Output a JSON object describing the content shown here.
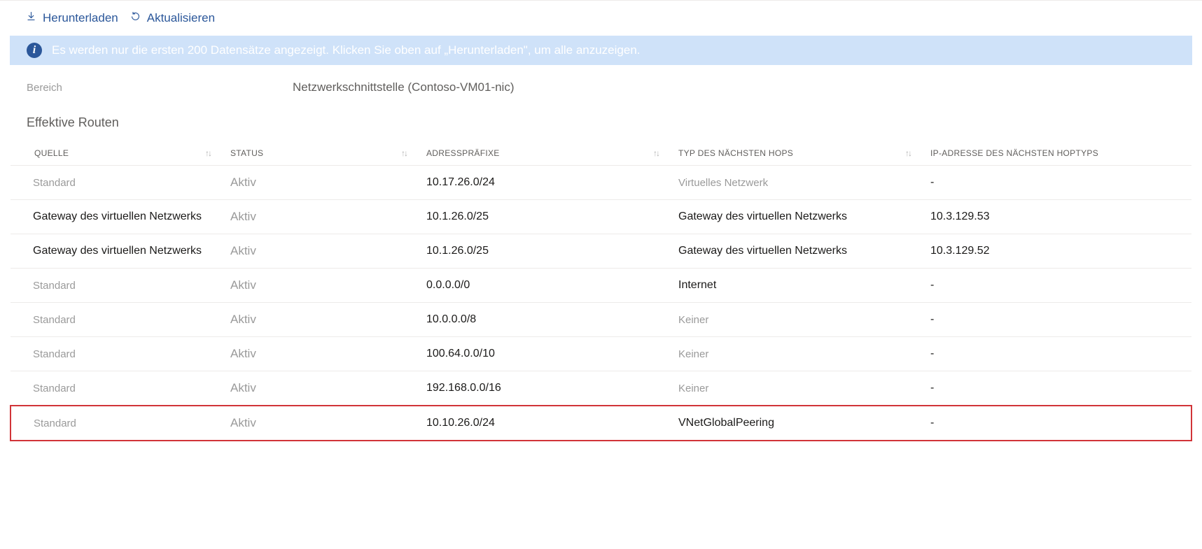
{
  "toolbar": {
    "download_label": "Herunterladen",
    "refresh_label": "Aktualisieren"
  },
  "info_message": "Es werden nur die ersten 200 Datensätze angezeigt. Klicken Sie oben auf „Herunterladen\", um alle anzuzeigen.",
  "scope": {
    "label": "Bereich",
    "value": "Netzwerkschnittstelle (Contoso-VM01-nic)"
  },
  "section_title": "Effektive Routen",
  "columns": {
    "source": "QUELLE",
    "status": "STATUS",
    "prefix": "ADRESSPRÄFIXE",
    "nexthop": "TYP DES NÄCHSTEN HOPS",
    "ip": "IP-ADRESSE DES NÄCHSTEN HOPTYPS"
  },
  "rows": [
    {
      "source": "Standard",
      "source_light": true,
      "status": "Aktiv",
      "prefix": "10.17.26.0/24",
      "nexthop": "Virtuelles Netzwerk",
      "nexthop_light": true,
      "ip": "-",
      "highlight": false
    },
    {
      "source": "Gateway des virtuellen Netzwerks",
      "source_light": false,
      "status": "Aktiv",
      "prefix": "10.1.26.0/25",
      "nexthop": "Gateway des virtuellen Netzwerks",
      "nexthop_light": false,
      "ip": "10.3.129.53",
      "highlight": false
    },
    {
      "source": "Gateway des virtuellen Netzwerks",
      "source_light": false,
      "status": "Aktiv",
      "prefix": "10.1.26.0/25",
      "nexthop": "Gateway des virtuellen Netzwerks",
      "nexthop_light": false,
      "ip": "10.3.129.52",
      "highlight": false
    },
    {
      "source": "Standard",
      "source_light": true,
      "status": "Aktiv",
      "prefix": "0.0.0.0/0",
      "nexthop": "Internet",
      "nexthop_light": false,
      "ip": "-",
      "highlight": false
    },
    {
      "source": "Standard",
      "source_light": true,
      "status": "Aktiv",
      "prefix": "10.0.0.0/8",
      "nexthop": "Keiner",
      "nexthop_light": true,
      "ip": "-",
      "highlight": false
    },
    {
      "source": "Standard",
      "source_light": true,
      "status": "Aktiv",
      "prefix": "100.64.0.0/10",
      "nexthop": "Keiner",
      "nexthop_light": true,
      "ip": "-",
      "highlight": false
    },
    {
      "source": "Standard",
      "source_light": true,
      "status": "Aktiv",
      "prefix": "192.168.0.0/16",
      "nexthop": "Keiner",
      "nexthop_light": true,
      "ip": "-",
      "highlight": false
    },
    {
      "source": "Standard",
      "source_light": true,
      "status": "Aktiv",
      "prefix": "10.10.26.0/24",
      "nexthop": "VNetGlobalPeering",
      "nexthop_light": false,
      "ip": "-",
      "highlight": true
    }
  ]
}
